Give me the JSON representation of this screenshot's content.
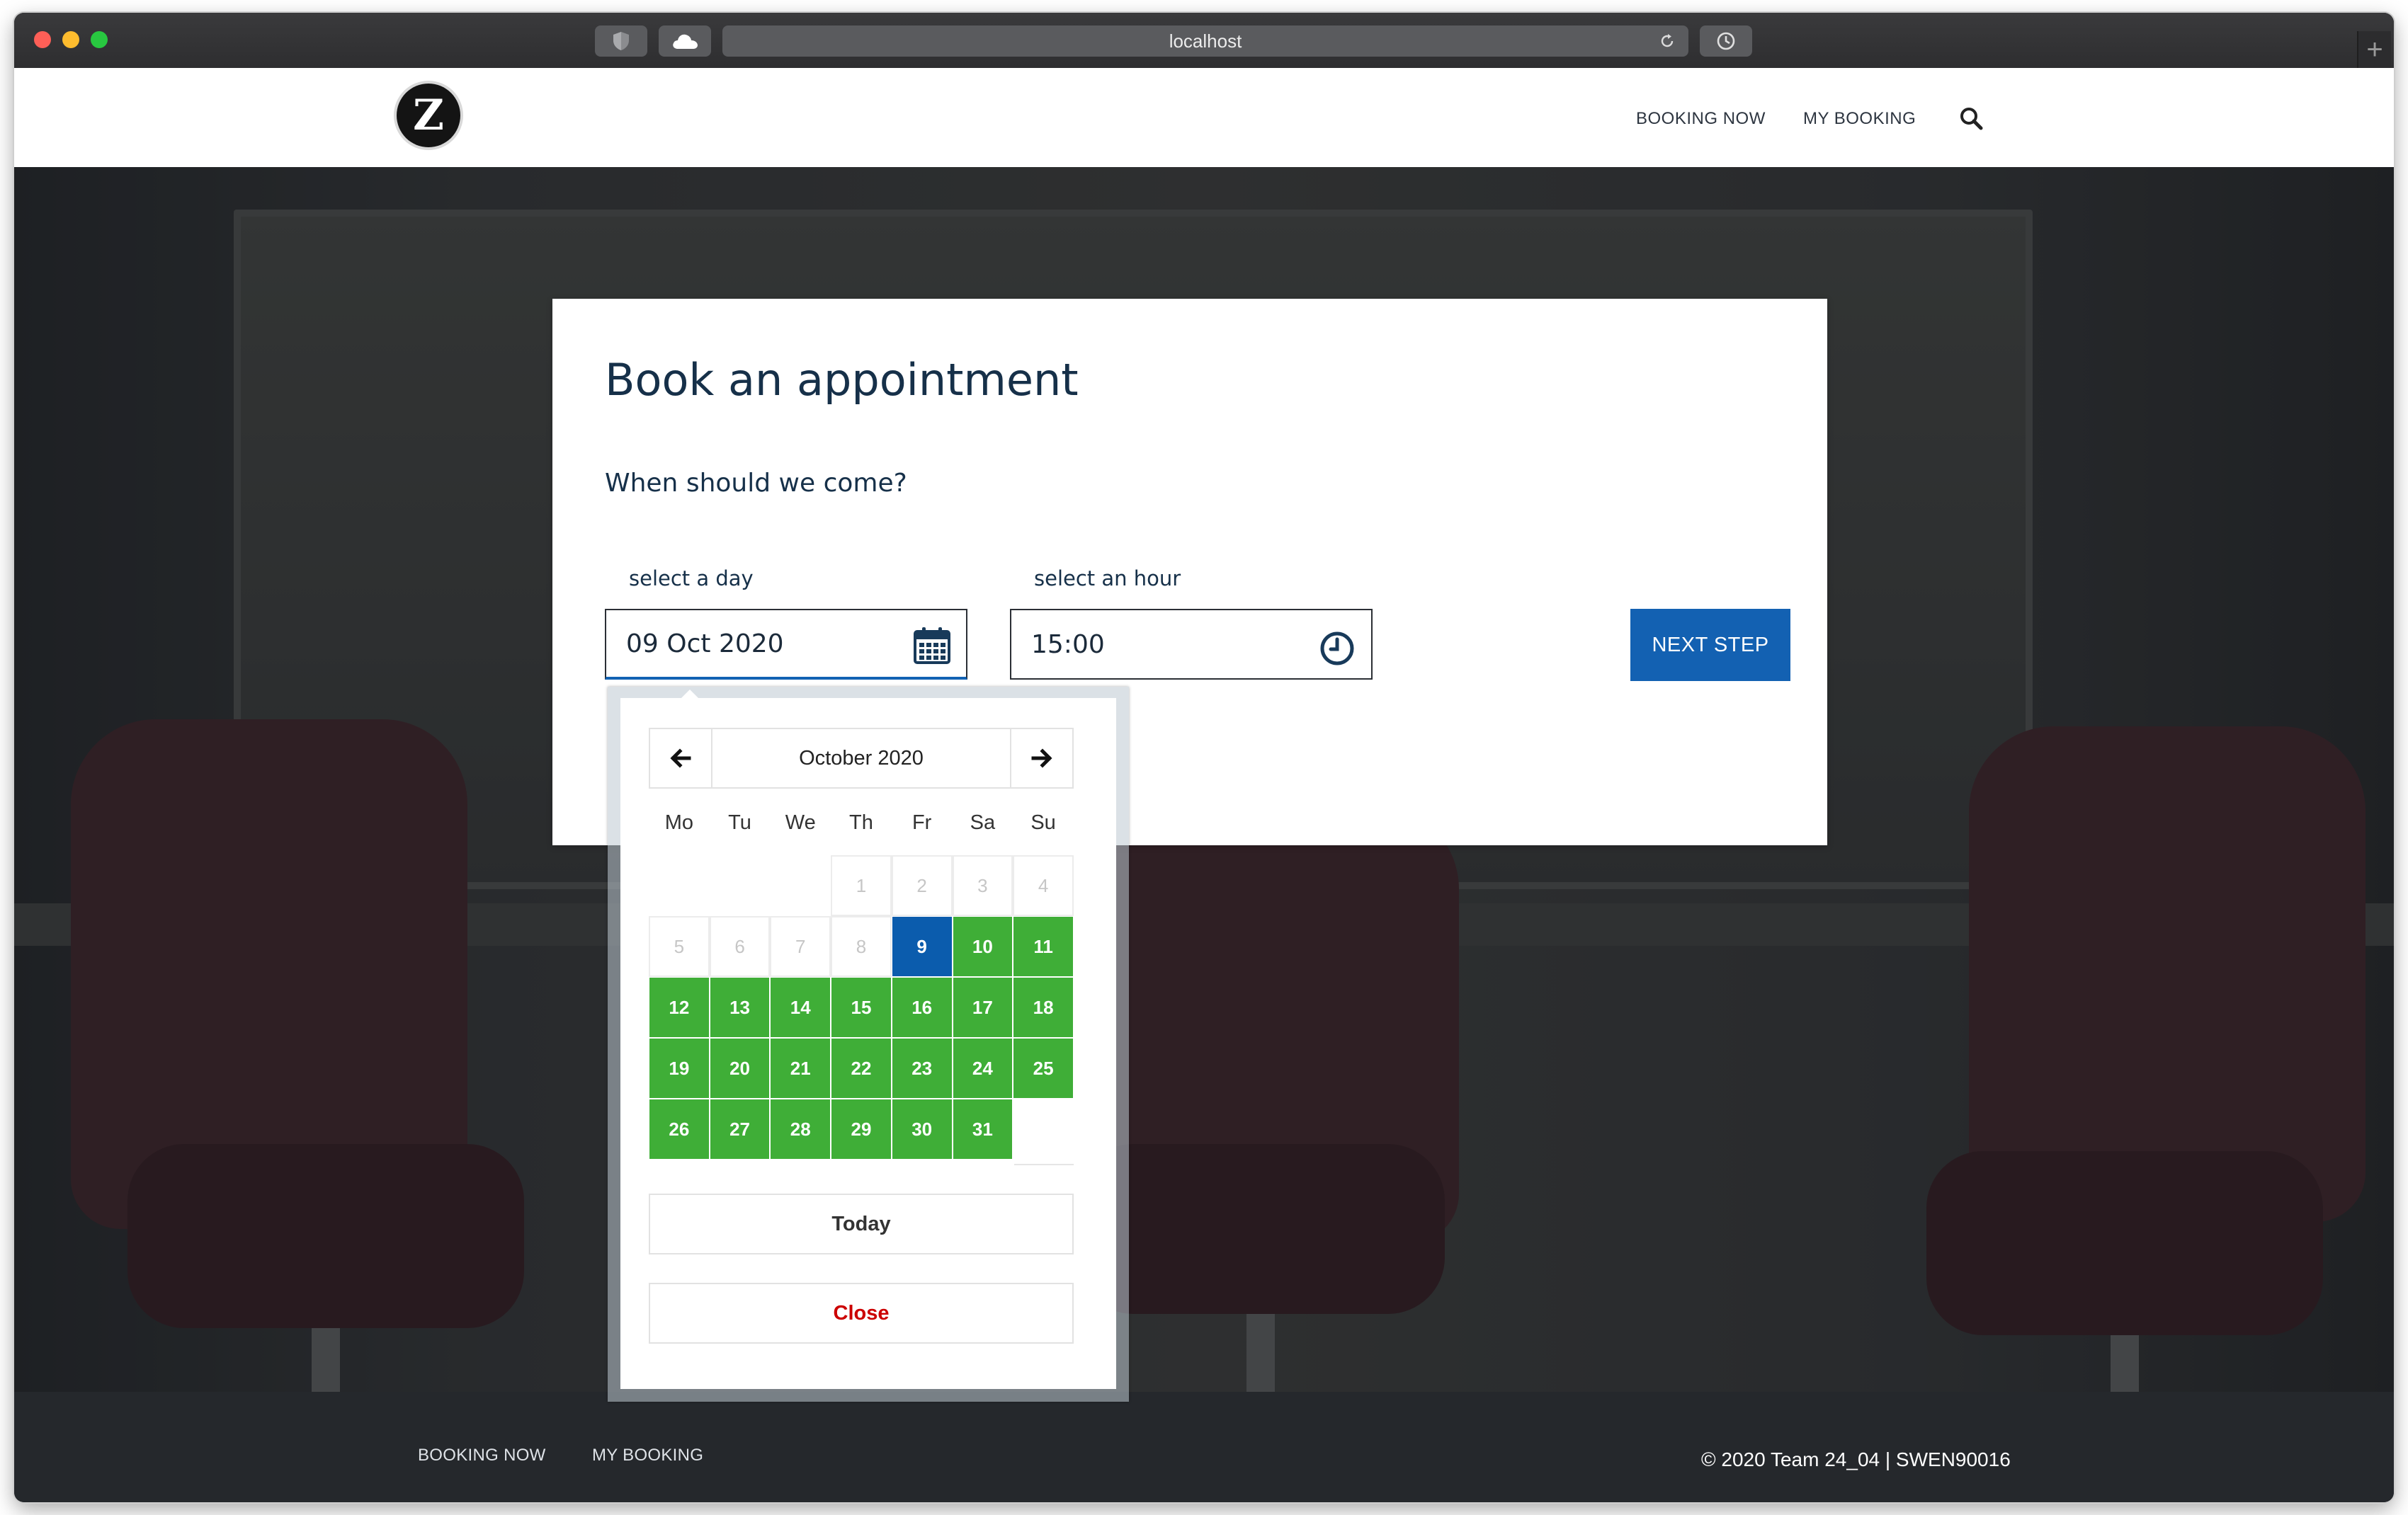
{
  "browser": {
    "url": "localhost",
    "icons": {
      "privacy": "shield-icon",
      "cloud": "cloud-icon",
      "reload": "reload-icon",
      "history": "clock-icon",
      "new_tab": "plus-icon"
    },
    "new_tab_label": "+"
  },
  "header": {
    "logo_letter": "Z",
    "nav": {
      "booking_now": "BOOKING NOW",
      "my_booking": "MY BOOKING"
    },
    "search_icon": "search-icon"
  },
  "booking": {
    "title": "Book an appointment",
    "subtitle": "When should we come?",
    "day_label": "select a day",
    "day_value": "09 Oct 2020",
    "hour_label": "select an hour",
    "hour_value": "15:00",
    "next_label": "NEXT STEP"
  },
  "datepicker": {
    "month_label": "October 2020",
    "weekdays": [
      "Mo",
      "Tu",
      "We",
      "Th",
      "Fr",
      "Sa",
      "Su"
    ],
    "leading_blank_days": 3,
    "days_in_month": 31,
    "past_days": [
      1,
      2,
      3,
      4,
      5,
      6,
      7,
      8
    ],
    "selected_day": 9,
    "today_label": "Today",
    "close_label": "Close",
    "colors": {
      "available": "#3fae37",
      "selected": "#0b5cad",
      "past": "#c6c6c6"
    }
  },
  "footer": {
    "booking_now": "BOOKING NOW",
    "my_booking": "MY BOOKING",
    "copyright": "© 2020 Team 24_04 | SWEN90016"
  }
}
